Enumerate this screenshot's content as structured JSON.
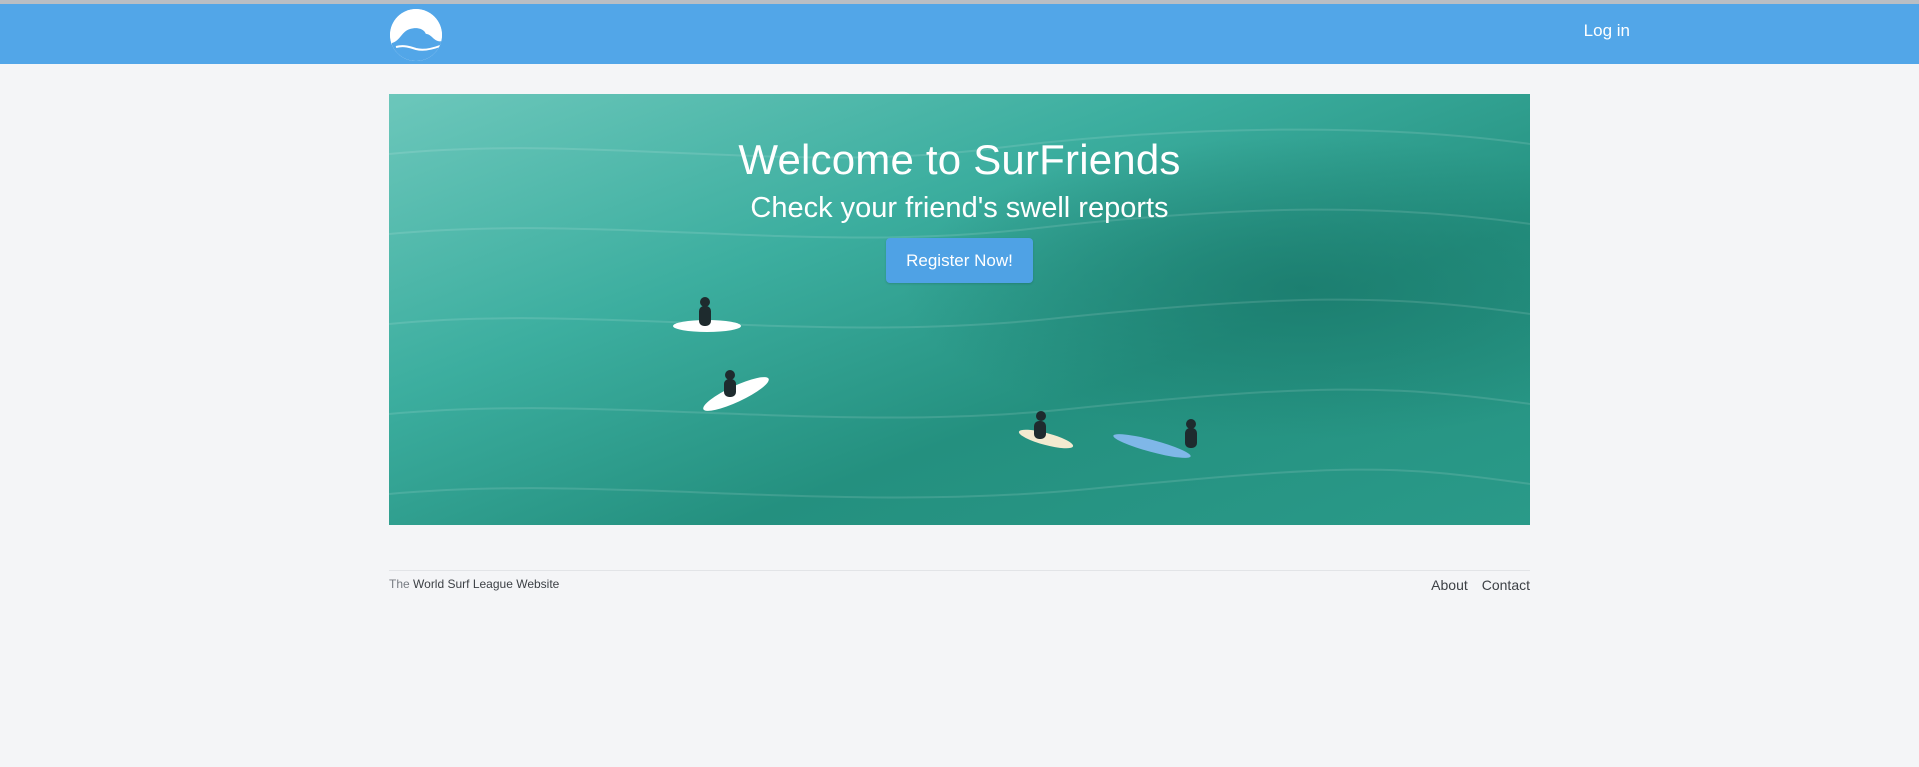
{
  "header": {
    "logo_icon": "wave-logo-icon",
    "login_label": "Log in",
    "bg_color": "#52a6e8"
  },
  "hero": {
    "title": "Welcome to SurFriends",
    "subtitle": "Check your friend's swell reports",
    "cta_label": "Register Now!"
  },
  "footer": {
    "prefix": "The",
    "site_name": "World Surf League Website",
    "links": [
      "About",
      "Contact"
    ]
  }
}
